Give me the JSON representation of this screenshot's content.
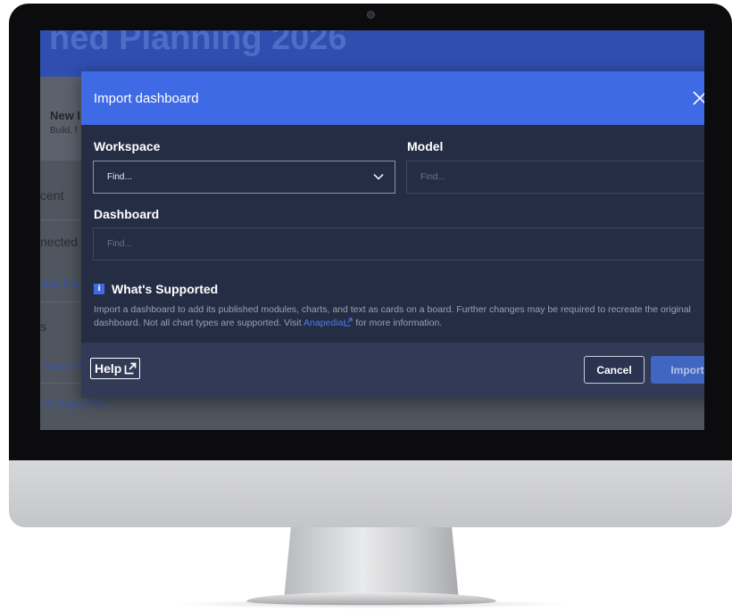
{
  "background": {
    "title": "ned Planning 2026",
    "card_title": "New I",
    "card_subtitle": "Build, f",
    "recent": "cent",
    "connected": "nected",
    "connected_link": "cted Pla",
    "s_label": "s",
    "sales_link_1": "Sales Pl",
    "sales_link_2": "nal Sales Plan"
  },
  "modal": {
    "title": "Import dashboard",
    "close_icon": "close-icon",
    "workspace_label": "Workspace",
    "workspace_value": "Find...",
    "model_label": "Model",
    "model_placeholder": "Find...",
    "dashboard_label": "Dashboard",
    "dashboard_placeholder": "Find...",
    "info_icon": "i",
    "supported_title": "What's Supported",
    "supported_text_1": "Import a dashboard to add its published modules, charts, and text as cards on a board. Further changes may be required to recreate the original dashboard. Not all chart types are supported. Visit",
    "supported_link": "Anapedia",
    "supported_text_2": "for more information.",
    "help_label": "Help",
    "cancel_label": "Cancel",
    "import_label": "Import"
  },
  "colors": {
    "accent": "#3f6ae5",
    "modal_bg": "#252d45",
    "footer_bg": "#313a56"
  }
}
